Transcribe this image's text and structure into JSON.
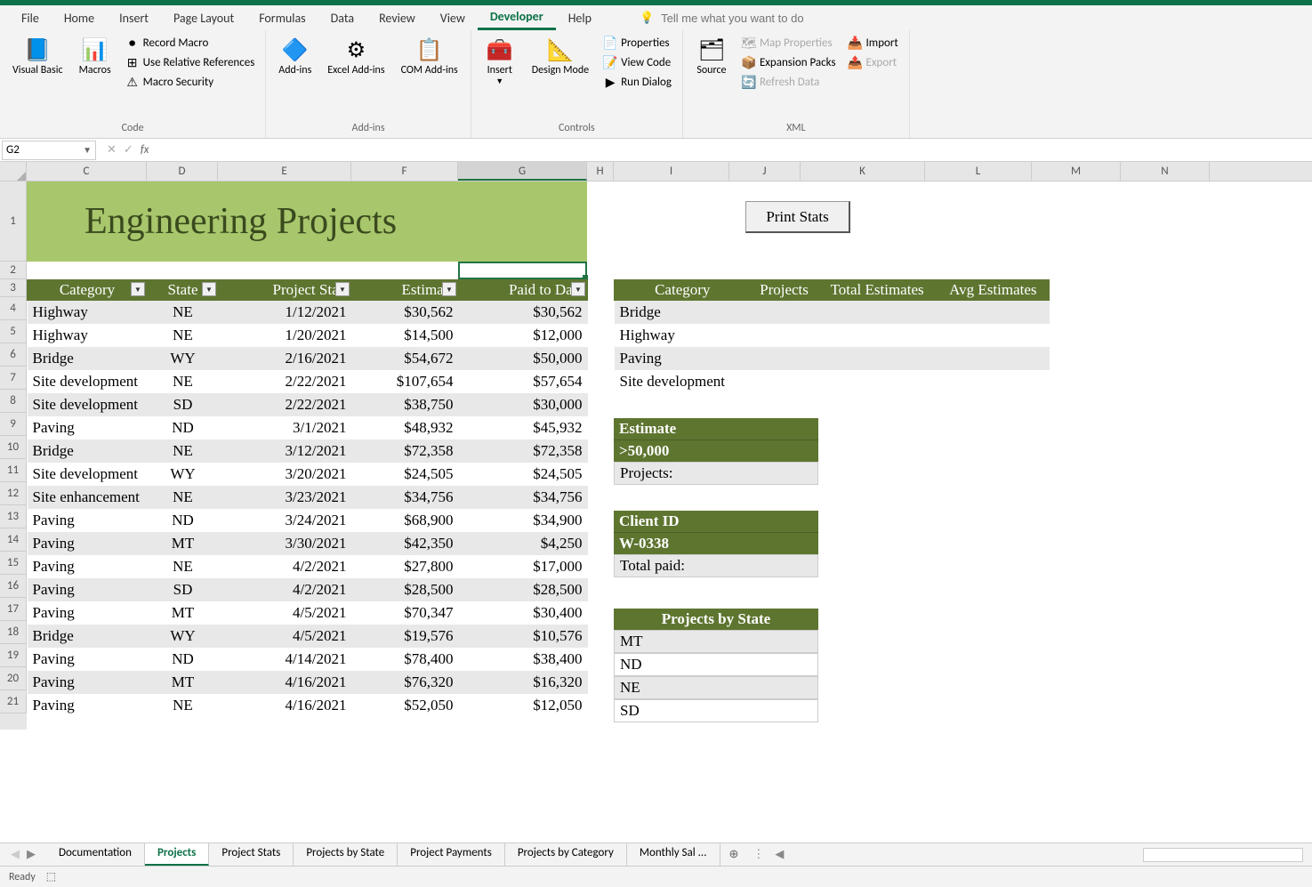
{
  "menu": {
    "tabs": [
      "File",
      "Home",
      "Insert",
      "Page Layout",
      "Formulas",
      "Data",
      "Review",
      "View",
      "Developer",
      "Help"
    ],
    "active": "Developer",
    "tell_me": "Tell me what you want to do"
  },
  "ribbon": {
    "code": {
      "label": "Code",
      "visual_basic": "Visual Basic",
      "macros": "Macros",
      "record_macro": "Record Macro",
      "use_relative": "Use Relative References",
      "macro_security": "Macro Security"
    },
    "addins": {
      "label": "Add-ins",
      "addins": "Add-ins",
      "excel_addins": "Excel Add-ins",
      "com_addins": "COM Add-ins"
    },
    "controls": {
      "label": "Controls",
      "insert": "Insert",
      "design_mode": "Design Mode",
      "properties": "Properties",
      "view_code": "View Code",
      "run_dialog": "Run Dialog"
    },
    "xml": {
      "label": "XML",
      "source": "Source",
      "map_properties": "Map Properties",
      "expansion_packs": "Expansion Packs",
      "refresh_data": "Refresh Data",
      "import": "Import",
      "export": "Export"
    }
  },
  "name_box": "G2",
  "columns": [
    "C",
    "D",
    "E",
    "F",
    "G",
    "H",
    "I",
    "J",
    "K",
    "L",
    "M",
    "N"
  ],
  "selected_col": "G",
  "title": "Engineering Projects",
  "print_button": "Print Stats",
  "main_headers": [
    "Category",
    "State",
    "Project Start",
    "Estimate",
    "Paid to Date"
  ],
  "rows": [
    {
      "n": 4,
      "cat": "Highway",
      "st": "NE",
      "start": "1/12/2021",
      "est": "$30,562",
      "paid": "$30,562",
      "band": true
    },
    {
      "n": 5,
      "cat": "Highway",
      "st": "NE",
      "start": "1/20/2021",
      "est": "$14,500",
      "paid": "$12,000",
      "band": false
    },
    {
      "n": 6,
      "cat": "Bridge",
      "st": "WY",
      "start": "2/16/2021",
      "est": "$54,672",
      "paid": "$50,000",
      "band": true
    },
    {
      "n": 7,
      "cat": "Site development",
      "st": "NE",
      "start": "2/22/2021",
      "est": "$107,654",
      "paid": "$57,654",
      "band": false
    },
    {
      "n": 8,
      "cat": "Site development",
      "st": "SD",
      "start": "2/22/2021",
      "est": "$38,750",
      "paid": "$30,000",
      "band": true
    },
    {
      "n": 9,
      "cat": "Paving",
      "st": "ND",
      "start": "3/1/2021",
      "est": "$48,932",
      "paid": "$45,932",
      "band": false
    },
    {
      "n": 10,
      "cat": "Bridge",
      "st": "NE",
      "start": "3/12/2021",
      "est": "$72,358",
      "paid": "$72,358",
      "band": true
    },
    {
      "n": 11,
      "cat": "Site development",
      "st": "WY",
      "start": "3/20/2021",
      "est": "$24,505",
      "paid": "$24,505",
      "band": false
    },
    {
      "n": 12,
      "cat": "Site enhancement",
      "st": "NE",
      "start": "3/23/2021",
      "est": "$34,756",
      "paid": "$34,756",
      "band": true
    },
    {
      "n": 13,
      "cat": "Paving",
      "st": "ND",
      "start": "3/24/2021",
      "est": "$68,900",
      "paid": "$34,900",
      "band": false
    },
    {
      "n": 14,
      "cat": "Paving",
      "st": "MT",
      "start": "3/30/2021",
      "est": "$42,350",
      "paid": "$4,250",
      "band": true
    },
    {
      "n": 15,
      "cat": "Paving",
      "st": "NE",
      "start": "4/2/2021",
      "est": "$27,800",
      "paid": "$17,000",
      "band": false
    },
    {
      "n": 16,
      "cat": "Paving",
      "st": "SD",
      "start": "4/2/2021",
      "est": "$28,500",
      "paid": "$28,500",
      "band": true
    },
    {
      "n": 17,
      "cat": "Paving",
      "st": "MT",
      "start": "4/5/2021",
      "est": "$70,347",
      "paid": "$30,400",
      "band": false
    },
    {
      "n": 18,
      "cat": "Bridge",
      "st": "WY",
      "start": "4/5/2021",
      "est": "$19,576",
      "paid": "$10,576",
      "band": true
    },
    {
      "n": 19,
      "cat": "Paving",
      "st": "ND",
      "start": "4/14/2021",
      "est": "$78,400",
      "paid": "$38,400",
      "band": false
    },
    {
      "n": 20,
      "cat": "Paving",
      "st": "MT",
      "start": "4/16/2021",
      "est": "$76,320",
      "paid": "$16,320",
      "band": true
    },
    {
      "n": 21,
      "cat": "Paving",
      "st": "NE",
      "start": "4/16/2021",
      "est": "$52,050",
      "paid": "$12,050",
      "band": false
    }
  ],
  "summary_headers": [
    "Category",
    "Projects",
    "Total Estimates",
    "Avg Estimates"
  ],
  "summary_rows": [
    {
      "cat": "Bridge",
      "band": true
    },
    {
      "cat": "Highway",
      "band": false
    },
    {
      "cat": "Paving",
      "band": true
    },
    {
      "cat": "Site development",
      "band": false
    }
  ],
  "estimate_block": {
    "h1": "Estimate",
    "h2": ">50,000",
    "label": "Projects:"
  },
  "client_block": {
    "h1": "Client ID",
    "h2": "W-0338",
    "label": "Total paid:"
  },
  "state_block": {
    "header": "Projects by State",
    "rows": [
      "MT",
      "ND",
      "NE",
      "SD"
    ]
  },
  "sheet_tabs": [
    "Documentation",
    "Projects",
    "Project Stats",
    "Projects by State",
    "Project Payments",
    "Projects by Category",
    "Monthly Sal ..."
  ],
  "active_sheet": "Projects",
  "status": "Ready"
}
